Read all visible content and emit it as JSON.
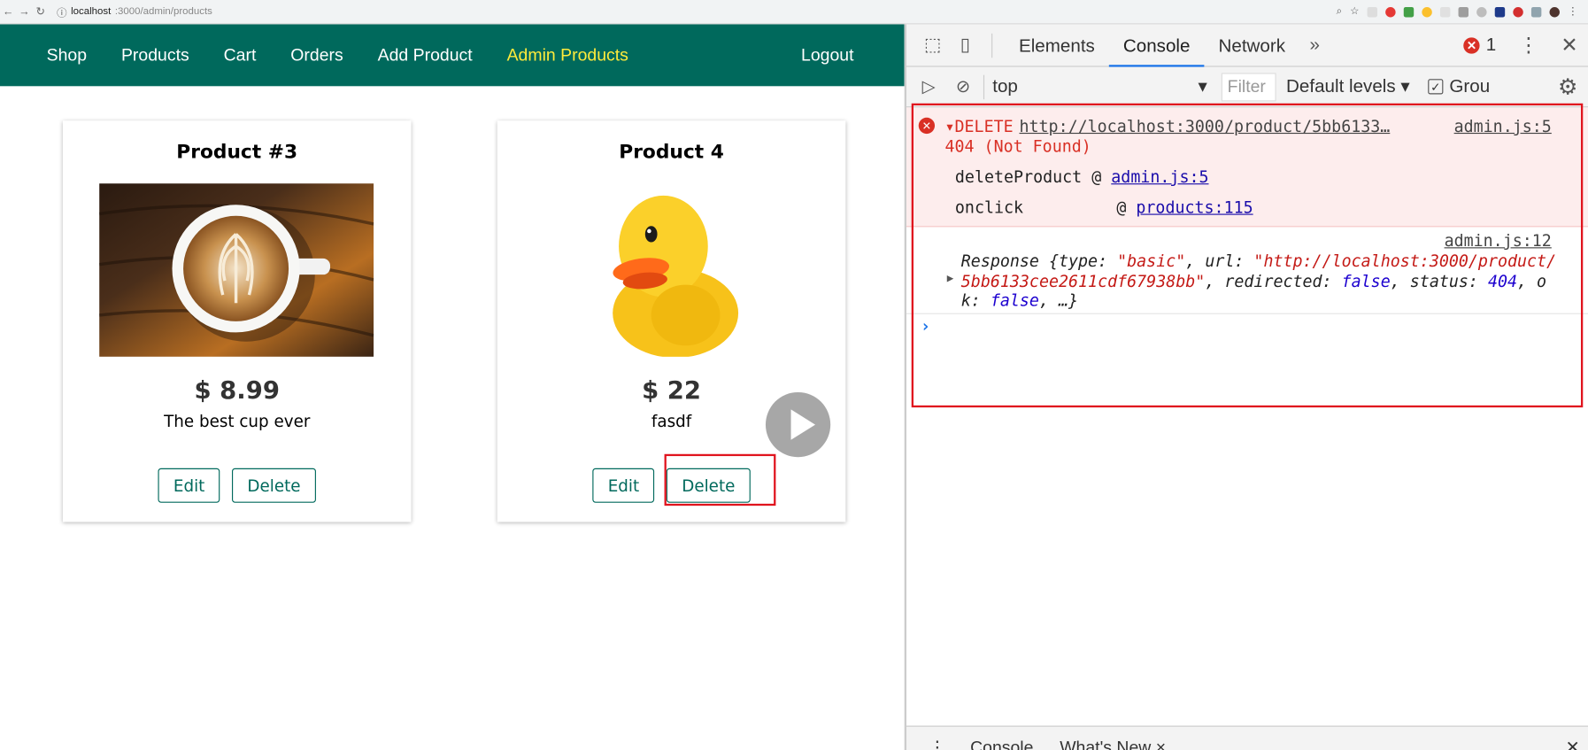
{
  "browser": {
    "url_host": "localhost",
    "url_path": ":3000/admin/products"
  },
  "nav": {
    "items": [
      "Shop",
      "Products",
      "Cart",
      "Orders",
      "Add Product",
      "Admin Products"
    ],
    "logout": "Logout",
    "active_color": "#ffeb3b",
    "bar_color": "#00695c"
  },
  "products": [
    {
      "title": "Product #3",
      "price": "$ 8.99",
      "description": "The best cup ever",
      "edit": "Edit",
      "delete": "Delete",
      "image": "latte-art-coffee-cup"
    },
    {
      "title": "Product 4",
      "price": "$ 22",
      "description": "fasdf",
      "edit": "Edit",
      "delete": "Delete",
      "image": "rubber-duck"
    }
  ],
  "devtools": {
    "tabs": [
      "Elements",
      "Console",
      "Network"
    ],
    "selected_tab": "Console",
    "more": "»",
    "error_count": "1",
    "context": "top",
    "filter_placeholder": "Filter",
    "levels": "Default levels",
    "group_label": "Grou",
    "error": {
      "method": "DELETE",
      "url": "http://localhost:3000/product/5bb6133…",
      "source": "admin.js:5",
      "status": "404 (Not Found)",
      "stack": [
        {
          "fn": "deleteProduct",
          "at": "@",
          "link": "admin.js:5"
        },
        {
          "fn": "onclick",
          "at": "@",
          "link": "products:115"
        }
      ]
    },
    "log": {
      "source": "admin.js:12",
      "prefix": "Response {type: ",
      "type_val": "\"basic\"",
      "url_key": ", url: ",
      "url_val": "\"http://localhost:3000/product/5bb6133cee2611cdf67938bb\"",
      "redirected_key": ", redirected: ",
      "redirected_val": "false",
      "status_key": ", status: ",
      "status_val": "404",
      "ok_key": ", ok: ",
      "ok_val": "false",
      "suffix": ", …}"
    },
    "prompt": "›",
    "drawer_tabs": [
      "Console",
      "What's New ×"
    ]
  }
}
